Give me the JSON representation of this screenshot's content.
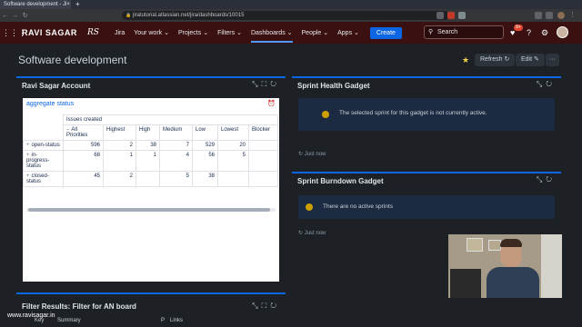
{
  "browser": {
    "tab_title": "Software development - Ji",
    "tab_close": "×",
    "new_tab": "+",
    "url": "jiratutorial.atlassian.net/jira/dashboards/10015"
  },
  "header": {
    "brand": "RAVI SAGAR",
    "brand_logo": "Jira",
    "product": "Jira",
    "menu": [
      "Your work ⌄",
      "Projects ⌄",
      "Filters ⌄",
      "Dashboards ⌄",
      "People ⌄",
      "Apps ⌄"
    ],
    "create_label": "Create",
    "search_placeholder": "Search",
    "notif_count": "9+"
  },
  "page": {
    "title": "Software development",
    "refresh_label": "Refresh",
    "edit_label": "Edit",
    "more_label": "···"
  },
  "account_gadget": {
    "title": "Ravi Sagar Account",
    "report_title": "aggregate status",
    "group_header": "Issues created",
    "columns": [
      "All Priorities",
      "Highest",
      "High",
      "Medium",
      "Low",
      "Lowest",
      "Blocker"
    ],
    "rows": [
      {
        "status": "open-status",
        "values": [
          "596",
          "2",
          "38",
          "7",
          "529",
          "20",
          ""
        ]
      },
      {
        "status": "in-progress-status",
        "values": [
          "68",
          "1",
          "1",
          "4",
          "56",
          "5",
          ""
        ]
      },
      {
        "status": "closed-status",
        "values": [
          "45",
          "2",
          "",
          "5",
          "38",
          "",
          ""
        ]
      }
    ]
  },
  "sprint_health": {
    "title": "Sprint Health Gadget",
    "message": "The selected sprint for this gadget is not currently active.",
    "updated": "Just now"
  },
  "sprint_burndown": {
    "title": "Sprint Burndown Gadget",
    "message": "There are no active sprints",
    "updated": "Just now"
  },
  "filter_gadget": {
    "title": "Filter Results: Filter for AN board",
    "columns": [
      "Key",
      "Summary",
      "P",
      "Links"
    ]
  },
  "watermark": "www.ravisagar.in",
  "colors": {
    "header_bg": "#3a1011",
    "accent": "#0c66e4",
    "warning_dot": "#cf9f02"
  }
}
